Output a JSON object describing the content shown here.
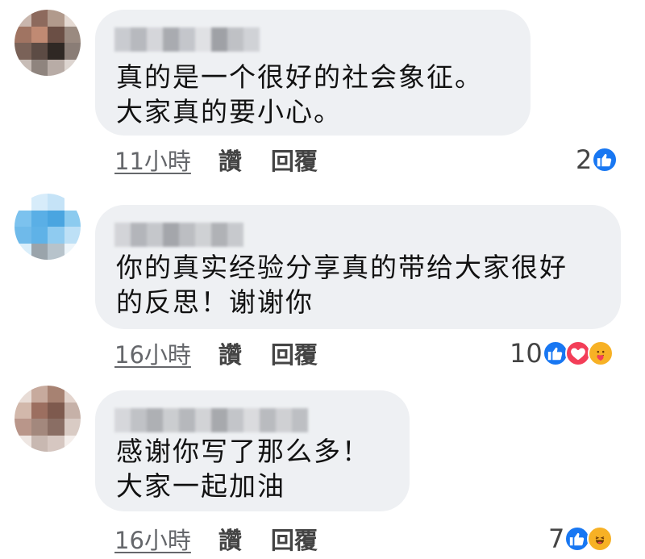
{
  "comments": [
    {
      "text": "真的是一个很好的社会象征。\n大家真的要小心。",
      "time": "11小時",
      "like_label": "讚",
      "reply_label": "回覆",
      "reaction_count": "2",
      "reactions": [
        "like"
      ]
    },
    {
      "text": "你的真实经验分享真的带给大家很好\n的反思！谢谢你",
      "time": "16小時",
      "like_label": "讚",
      "reply_label": "回覆",
      "reaction_count": "10",
      "reactions": [
        "like",
        "love",
        "care"
      ]
    },
    {
      "text": "感谢你写了那么多！\n大家一起加油",
      "time": "16小時",
      "like_label": "讚",
      "reply_label": "回覆",
      "reaction_count": "7",
      "reactions": [
        "like",
        "haha"
      ]
    }
  ],
  "colors": {
    "bubble": "#eef0f3",
    "like_blue": "#1877f2",
    "love_red": "#f33e58",
    "emoji_yellow": "#f7b125"
  }
}
